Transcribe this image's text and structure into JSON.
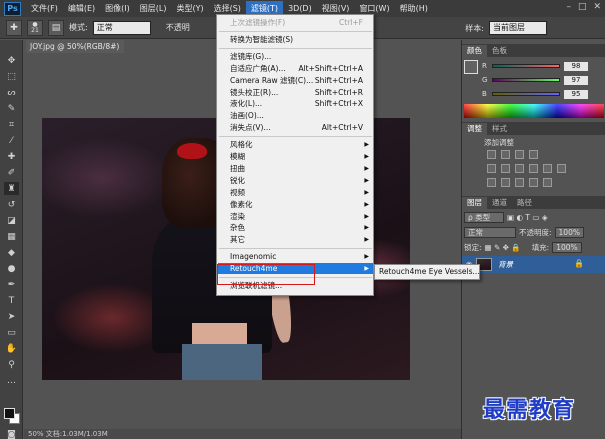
{
  "app": {
    "logo": "Ps"
  },
  "menubar": {
    "items": [
      "文件(F)",
      "编辑(E)",
      "图像(I)",
      "图层(L)",
      "类型(Y)",
      "选择(S)",
      "滤镜(T)",
      "3D(D)",
      "视图(V)",
      "窗口(W)",
      "帮助(H)"
    ],
    "active": "滤镜(T)",
    "window_controls": [
      "–",
      "□",
      "✕"
    ]
  },
  "options": {
    "brush_size": "21",
    "mode_label": "模式:",
    "mode_value": "正常",
    "opacity_label": "不透明",
    "sample_label": "样本:",
    "sample_value": "当前图层"
  },
  "document": {
    "tab": "JOY.jpg @ 50%(RGB/8#)",
    "status": "50%     文档:1.03M/1.03M"
  },
  "filter_menu": {
    "items": [
      {
        "label": "上次滤镜操作(F)",
        "shortcut": "Ctrl+F",
        "disabled": true
      },
      {
        "separator": true
      },
      {
        "label": "转换为智能滤镜(S)"
      },
      {
        "separator": true
      },
      {
        "label": "滤镜库(G)..."
      },
      {
        "label": "自适应广角(A)...",
        "shortcut": "Alt+Shift+Ctrl+A"
      },
      {
        "label": "Camera Raw 滤镜(C)...",
        "shortcut": "Shift+Ctrl+A"
      },
      {
        "label": "镜头校正(R)...",
        "shortcut": "Shift+Ctrl+R"
      },
      {
        "label": "液化(L)...",
        "shortcut": "Shift+Ctrl+X"
      },
      {
        "label": "油画(O)..."
      },
      {
        "label": "消失点(V)...",
        "shortcut": "Alt+Ctrl+V"
      },
      {
        "separator": true
      },
      {
        "label": "风格化",
        "submenu": true
      },
      {
        "label": "模糊",
        "submenu": true
      },
      {
        "label": "扭曲",
        "submenu": true
      },
      {
        "label": "锐化",
        "submenu": true
      },
      {
        "label": "视频",
        "submenu": true
      },
      {
        "label": "像素化",
        "submenu": true
      },
      {
        "label": "渲染",
        "submenu": true
      },
      {
        "label": "杂色",
        "submenu": true
      },
      {
        "label": "其它",
        "submenu": true
      },
      {
        "separator": true
      },
      {
        "label": "Imagenomic",
        "submenu": true
      },
      {
        "label": "Retouch4me",
        "submenu": true,
        "highlighted": true
      },
      {
        "separator": true
      },
      {
        "label": "浏览联机滤镜..."
      }
    ]
  },
  "submenu": {
    "item": "Retouch4me Eye Vessels..."
  },
  "color_panel": {
    "tabs": [
      "颜色",
      "色板"
    ],
    "sliders": [
      {
        "letter": "R",
        "value": "98"
      },
      {
        "letter": "G",
        "value": "97"
      },
      {
        "letter": "B",
        "value": "95"
      }
    ]
  },
  "adjust_panel": {
    "tabs": [
      "调整",
      "样式"
    ],
    "title": "添加调整"
  },
  "layers_panel": {
    "tabs": [
      "图层",
      "通道",
      "路径"
    ],
    "kind_label": "ρ 类型",
    "blend_mode": "正常",
    "opacity_label": "不透明度:",
    "opacity_value": "100%",
    "lock_label": "锁定:",
    "fill_label": "填充:",
    "fill_value": "100%",
    "layer_name": "背景"
  },
  "watermark": "最需教育",
  "colors": {
    "accent": "#1f7be0",
    "highlight_box": "#d61a1a",
    "watermark": "#1f3cc6"
  }
}
